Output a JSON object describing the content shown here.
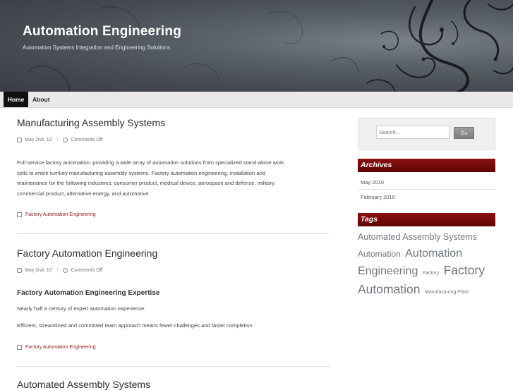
{
  "site": {
    "title": "Automation Engineering",
    "description": "Automation Systems Integration and Engineering Solutions"
  },
  "nav": {
    "items": [
      "Home",
      "About"
    ]
  },
  "posts": [
    {
      "title": "Manufacturing Assembly Systems",
      "date": "May 2nd, 10",
      "comments": "Comments Off",
      "body_lines": [
        "Full service factory automation: providing a wide array of automation solutions from specialized stand-alone work",
        "cells to entire turnkey manufacturing assembly systems. Factory automation engineering, installation and",
        "maintenance for the following industries: consumer product, medical device, aerospace and defense, military,",
        "commercial product, alternative energy, and automotive."
      ],
      "category": "Factory Automation Engineering"
    },
    {
      "title": "Factory Automation Engineering",
      "date": "May 2nd, 10",
      "comments": "Comments Off",
      "subheading": "Factory Automation Engineering Expertise",
      "paragraphs": [
        "Nearly half a century of expert automation experience.",
        "Efficient, streamlined and committed team approach means fewer challenges and faster completion."
      ],
      "category": "Factory Automation Engineering"
    },
    {
      "title": "Automated Assembly Systems"
    }
  ],
  "sidebar": {
    "search": {
      "placeholder": "Search...",
      "button": "Go"
    },
    "archives": {
      "title": "Archives",
      "items": [
        "May 2010",
        "February 2010"
      ]
    },
    "tags": {
      "title": "Tags",
      "items": [
        "Automated Assembly Systems",
        "Automation",
        "Automation Engineering",
        "Factory",
        "Factory Automation",
        "Manufacturing Plant"
      ]
    }
  }
}
